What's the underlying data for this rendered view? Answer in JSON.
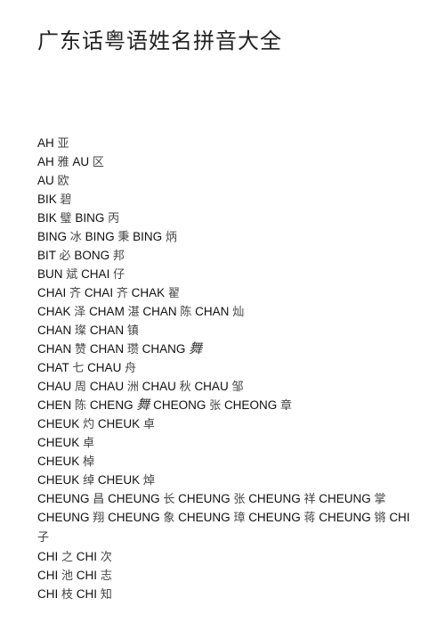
{
  "title": "广东话粤语姓名拼音大全",
  "lines": [
    [
      [
        "AH",
        "亚"
      ]
    ],
    [
      [
        "AH",
        "雅"
      ],
      [
        "AU",
        "区"
      ]
    ],
    [
      [
        "AU",
        "欧"
      ]
    ],
    [
      [
        "BIK",
        "碧"
      ]
    ],
    [
      [
        "BIK",
        "璧"
      ],
      [
        "BING",
        "丙"
      ]
    ],
    [
      [
        "BING",
        "冰"
      ],
      [
        "BING",
        "秉"
      ],
      [
        "BING",
        "炳"
      ]
    ],
    [
      [
        "BIT",
        "必"
      ],
      [
        "BONG",
        "邦"
      ]
    ],
    [
      [
        "BUN",
        "斌"
      ],
      [
        "CHAI",
        "仔"
      ]
    ],
    [
      [
        "CHAI",
        "齐"
      ],
      [
        "CHAI",
        "齐"
      ],
      [
        "CHAK",
        "翟"
      ]
    ],
    [
      [
        "CHAK",
        "泽"
      ],
      [
        "CHAM",
        "湛"
      ],
      [
        "CHAN",
        "陈"
      ],
      [
        "CHAN",
        "灿"
      ]
    ],
    [
      [
        "CHAN",
        "璨"
      ],
      [
        "CHAN",
        "镇"
      ]
    ],
    [
      [
        "CHAN",
        "赞"
      ],
      [
        "CHAN",
        "瓒"
      ],
      [
        "CHANG",
        "舞"
      ]
    ],
    [
      [
        "CHAT",
        "七"
      ],
      [
        "CHAU",
        "舟"
      ]
    ],
    [
      [
        "CHAU",
        "周"
      ],
      [
        "CHAU",
        "洲"
      ],
      [
        "CHAU",
        "秋"
      ],
      [
        "CHAU",
        "邹"
      ]
    ],
    [
      [
        "CHEN",
        "陈"
      ],
      [
        "CHENG",
        "舞"
      ],
      [
        "CHEONG",
        "张"
      ],
      [
        "CHEONG",
        "章"
      ]
    ],
    [
      [
        "CHEUK",
        "灼"
      ],
      [
        "CHEUK",
        "卓"
      ]
    ],
    [
      [
        "CHEUK",
        "卓"
      ]
    ],
    [
      [
        "CHEUK",
        "棹"
      ]
    ],
    [
      [
        "CHEUK",
        "绰"
      ],
      [
        "CHEUK",
        "焯"
      ]
    ],
    [
      [
        "CHEUNG",
        "昌"
      ],
      [
        "CHEUNG",
        "长"
      ],
      [
        "CHEUNG",
        "张"
      ],
      [
        "CHEUNG",
        "祥"
      ],
      [
        "CHEUNG",
        "掌"
      ]
    ],
    [
      [
        "CHEUNG",
        "翔"
      ],
      [
        "CHEUNG",
        "象"
      ],
      [
        "CHEUNG",
        "璋"
      ],
      [
        "CHEUNG",
        "蒋"
      ],
      [
        "CHEUNG",
        "锵"
      ],
      [
        "CHI",
        "子"
      ]
    ],
    [
      [
        "CHI",
        "之"
      ],
      [
        "CHI",
        "次"
      ]
    ],
    [
      [
        "CHI",
        "池"
      ],
      [
        "CHI",
        "志"
      ]
    ],
    [
      [
        "CHI",
        "枝"
      ],
      [
        "CHI",
        "知"
      ]
    ]
  ],
  "italic_chars": [
    "舞"
  ]
}
